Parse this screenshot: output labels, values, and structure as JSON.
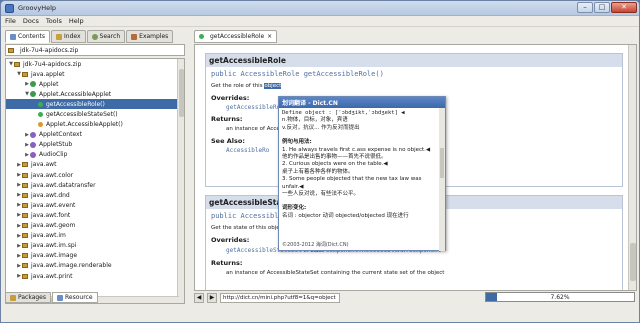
{
  "window": {
    "title": "GroovyHelp",
    "buttons": {
      "minimize": "–",
      "maximize": "□",
      "close": "✕"
    }
  },
  "menu": [
    "File",
    "Docs",
    "Tools",
    "Help"
  ],
  "left_tabs": [
    {
      "label": "Contents",
      "icon": "book-icon",
      "active": true
    },
    {
      "label": "Index",
      "icon": "index-icon",
      "active": false
    },
    {
      "label": "Search",
      "icon": "search-icon",
      "active": false
    },
    {
      "label": "Examples",
      "icon": "examples-icon",
      "active": false
    }
  ],
  "tree_root": "jdk-7u4-apidocs.zip",
  "tree": [
    {
      "label": "jdk-7u4-apidocs.zip",
      "type": "pkg",
      "indent": 0,
      "toggle": "▼"
    },
    {
      "label": "java.applet",
      "type": "pkg",
      "indent": 1,
      "toggle": "▼"
    },
    {
      "label": "Applet",
      "type": "cls",
      "indent": 2,
      "toggle": "▶"
    },
    {
      "label": "Applet.AccessibleApplet",
      "type": "cls",
      "indent": 2,
      "toggle": "▼"
    },
    {
      "label": "getAccessibleRole()",
      "type": "mth",
      "indent": 3,
      "toggle": "",
      "selected": true
    },
    {
      "label": "getAccessibleStateSet()",
      "type": "mth",
      "indent": 3,
      "toggle": ""
    },
    {
      "label": "Applet.AccessibleApplet()",
      "type": "mthp",
      "indent": 3,
      "toggle": ""
    },
    {
      "label": "AppletContext",
      "type": "clsi",
      "indent": 2,
      "toggle": "▶"
    },
    {
      "label": "AppletStub",
      "type": "clsi",
      "indent": 2,
      "toggle": "▶"
    },
    {
      "label": "AudioClip",
      "type": "clsi",
      "indent": 2,
      "toggle": "▶"
    },
    {
      "label": "java.awt",
      "type": "pkg",
      "indent": 1,
      "toggle": "▶"
    },
    {
      "label": "java.awt.color",
      "type": "pkg",
      "indent": 1,
      "toggle": "▶"
    },
    {
      "label": "java.awt.datatransfer",
      "type": "pkg",
      "indent": 1,
      "toggle": "▶"
    },
    {
      "label": "java.awt.dnd",
      "type": "pkg",
      "indent": 1,
      "toggle": "▶"
    },
    {
      "label": "java.awt.event",
      "type": "pkg",
      "indent": 1,
      "toggle": "▶"
    },
    {
      "label": "java.awt.font",
      "type": "pkg",
      "indent": 1,
      "toggle": "▶"
    },
    {
      "label": "java.awt.geom",
      "type": "pkg",
      "indent": 1,
      "toggle": "▶"
    },
    {
      "label": "java.awt.im",
      "type": "pkg",
      "indent": 1,
      "toggle": "▶"
    },
    {
      "label": "java.awt.im.spi",
      "type": "pkg",
      "indent": 1,
      "toggle": "▶"
    },
    {
      "label": "java.awt.image",
      "type": "pkg",
      "indent": 1,
      "toggle": "▶"
    },
    {
      "label": "java.awt.image.renderable",
      "type": "pkg",
      "indent": 1,
      "toggle": "▶"
    },
    {
      "label": "java.awt.print",
      "type": "pkg",
      "indent": 1,
      "toggle": "▶"
    }
  ],
  "bottom_tabs": [
    {
      "label": "Packages",
      "active": false
    },
    {
      "label": "Resource",
      "active": true
    }
  ],
  "doc_tab": {
    "label": "getAccessibleRole",
    "close": "×"
  },
  "doc": {
    "block1": {
      "heading": "getAccessibleRole",
      "signature": "public AccessibleRole getAccessibleRole()",
      "desc_prefix": "Get the role of this ",
      "desc_highlight": "object",
      "overrides_label": "Overrides:",
      "overrides_code": "getAccessibleRo",
      "returns_label": "Returns:",
      "returns_text": "an instance of Accessib",
      "see_also_label": "See Also:",
      "see_also_code": "AccessibleRo"
    },
    "block2": {
      "heading": "getAccessibleState",
      "signature": "public AccessibleSta",
      "desc": "Get the state of this object",
      "overrides_label": "Overrides:",
      "overrides_code": "getAccessibleStateSet",
      "overrides_text": " in class ",
      "overrides_class": "Component.AccessibleAWTComponent",
      "returns_label": "Returns:",
      "returns_text": "an instance of AccessibleStateSet containing the current state set of the object"
    }
  },
  "popup": {
    "title": "划词翻译 - Dict.CN",
    "lines": [
      "Define object : [ˈɔbdʒikt,ˈɔbdʒekt] ◀",
      "n.物体，目标，对象，宾语",
      "v.反对，抗议... 作为反对而提出",
      "",
      "例句与用法:",
      "1. He always travels first c.ass expense is no object.◀",
      "   他的作品是出售的事物——首先不说很低。",
      "2. Curious objects were on the table.◀",
      "   桌子上有着各种各样的物体。",
      "3. Some people objected that the new tax law was unfair.◀",
      "   一些人反对说，有些法不公平。",
      "",
      "词形变化:",
      "名词 : objector  动词  objected/objected  现在进行"
    ],
    "footer": "©2003-2012 海词(Dict.CN)"
  },
  "status": {
    "url": "http://dict.cn/mini.php?utf8=1&q=object",
    "progress_value": 7.62,
    "progress_text": "7.62%"
  },
  "colors": {
    "selection": "#3e6aa5",
    "block_header": "#d5deea",
    "code": "#5070a0"
  }
}
